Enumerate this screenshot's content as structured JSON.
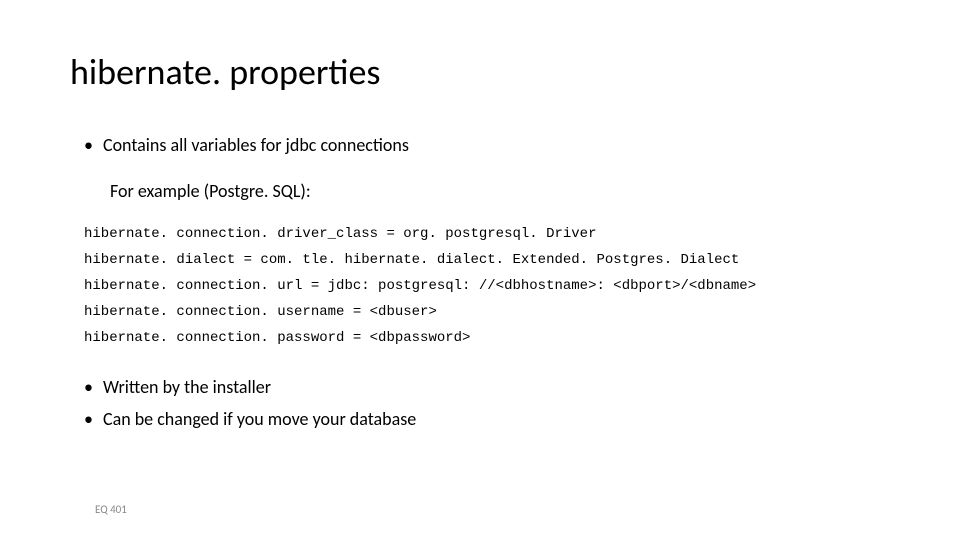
{
  "title": "hibernate. properties",
  "bullet1": "Contains all variables for jdbc connections",
  "subline": "For example (Postgre. SQL):",
  "code": {
    "line1": "hibernate. connection. driver_class = org. postgresql. Driver",
    "line2": "hibernate. dialect = com. tle. hibernate. dialect. Extended. Postgres. Dialect",
    "line3": "hibernate. connection. url = jdbc: postgresql: //<dbhostname>: <dbport>/<dbname>",
    "line4": "hibernate. connection. username = <dbuser>",
    "line5": "hibernate. connection. password = <dbpassword>"
  },
  "bullet2": "Written by the installer",
  "bullet3": "Can be changed if you move your database",
  "footer": "EQ 401"
}
